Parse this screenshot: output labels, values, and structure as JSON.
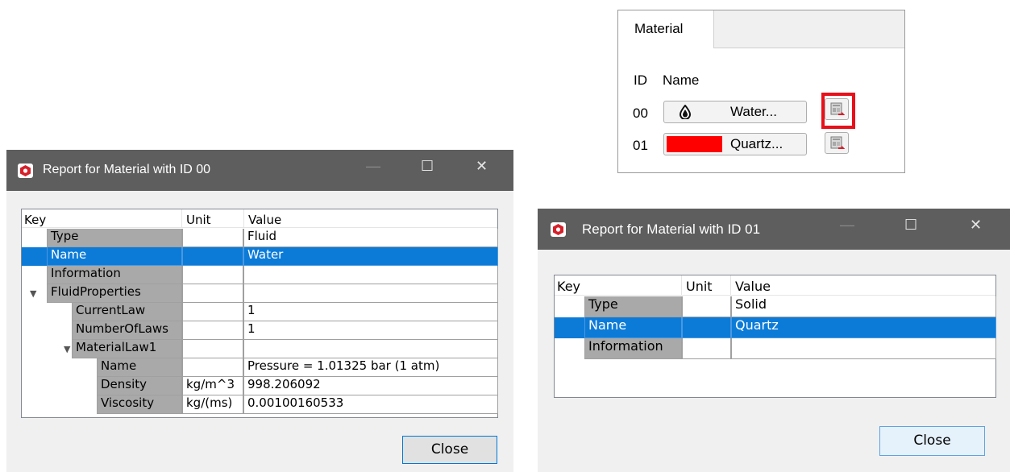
{
  "material_panel": {
    "tab_label": "Material",
    "header_id": "ID",
    "header_name": "Name",
    "rows": [
      {
        "id": "00",
        "name_button": "Water...",
        "icon": "water-drop-icon"
      },
      {
        "id": "01",
        "name_button": "Quartz...",
        "color": "#ff0000"
      }
    ]
  },
  "dialog_water": {
    "title": "Report for Material with ID 00",
    "columns": {
      "key": "Key",
      "unit": "Unit",
      "value": "Value"
    },
    "rows": [
      {
        "key": "Type",
        "unit": "",
        "value": "Fluid"
      },
      {
        "key": "Name",
        "unit": "",
        "value": "Water"
      },
      {
        "key": "Information",
        "unit": "",
        "value": ""
      },
      {
        "key": "FluidProperties",
        "unit": "",
        "value": ""
      },
      {
        "key": "CurrentLaw",
        "unit": "",
        "value": "1"
      },
      {
        "key": "NumberOfLaws",
        "unit": "",
        "value": "1"
      },
      {
        "key": "MaterialLaw1",
        "unit": "",
        "value": ""
      },
      {
        "key": "Name",
        "unit": "",
        "value": "Pressure = 1.01325 bar (1 atm)"
      },
      {
        "key": "Density",
        "unit": "kg/m^3",
        "value": "998.206092"
      },
      {
        "key": "Viscosity",
        "unit": "kg/(ms)",
        "value": "0.00100160533"
      }
    ],
    "close_label": "Close"
  },
  "dialog_quartz": {
    "title": "Report for Material with ID 01",
    "columns": {
      "key": "Key",
      "unit": "Unit",
      "value": "Value"
    },
    "rows": [
      {
        "key": "Type",
        "unit": "",
        "value": "Solid"
      },
      {
        "key": "Name",
        "unit": "",
        "value": "Quartz"
      },
      {
        "key": "Information",
        "unit": "",
        "value": ""
      }
    ],
    "close_label": "Close"
  },
  "window_controls": {
    "minimize": "—",
    "maximize": "☐",
    "close": "✕"
  },
  "colors": {
    "titlebar": "#5e5e5e",
    "selection": "#0c7bd8",
    "key_cell": "#a9a9a9",
    "highlight": "#e8101a",
    "app_icon": "#d6202a"
  }
}
